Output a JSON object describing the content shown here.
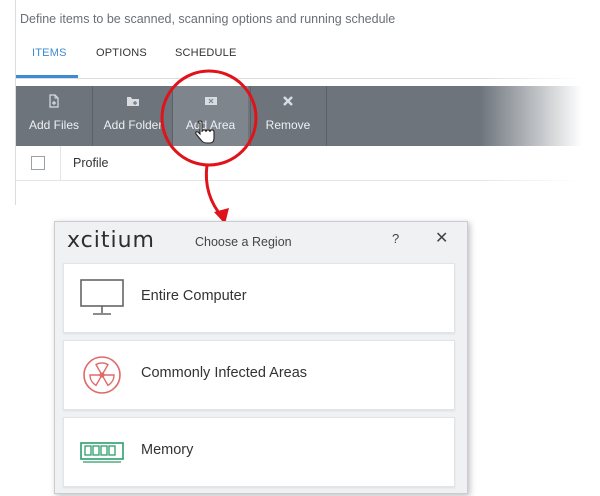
{
  "description": "Define items to be scanned, scanning options and running schedule",
  "tabs": [
    {
      "label": "ITEMS"
    },
    {
      "label": "OPTIONS"
    },
    {
      "label": "SCHEDULE"
    }
  ],
  "toolbar": [
    {
      "label": "Add Files",
      "icon": "add-file-icon"
    },
    {
      "label": "Add Folder",
      "icon": "add-folder-icon"
    },
    {
      "label": "Add Area",
      "icon": "add-area-icon"
    },
    {
      "label": "Remove",
      "icon": "remove-icon"
    }
  ],
  "table": {
    "column_profile": "Profile"
  },
  "dialog": {
    "logo": "xcitium",
    "title": "Choose a Region",
    "help": "?",
    "close": "✕",
    "options": [
      {
        "label": "Entire Computer",
        "icon": "monitor-icon"
      },
      {
        "label": "Commonly Infected Areas",
        "icon": "radiation-icon"
      },
      {
        "label": "Memory",
        "icon": "memory-chip-icon"
      }
    ]
  },
  "colors": {
    "accent": "#3d8bd0",
    "toolbar": "#6d747c",
    "callout": "#e0131a",
    "radiation": "#e06a6a",
    "memory": "#2e9e6a"
  }
}
